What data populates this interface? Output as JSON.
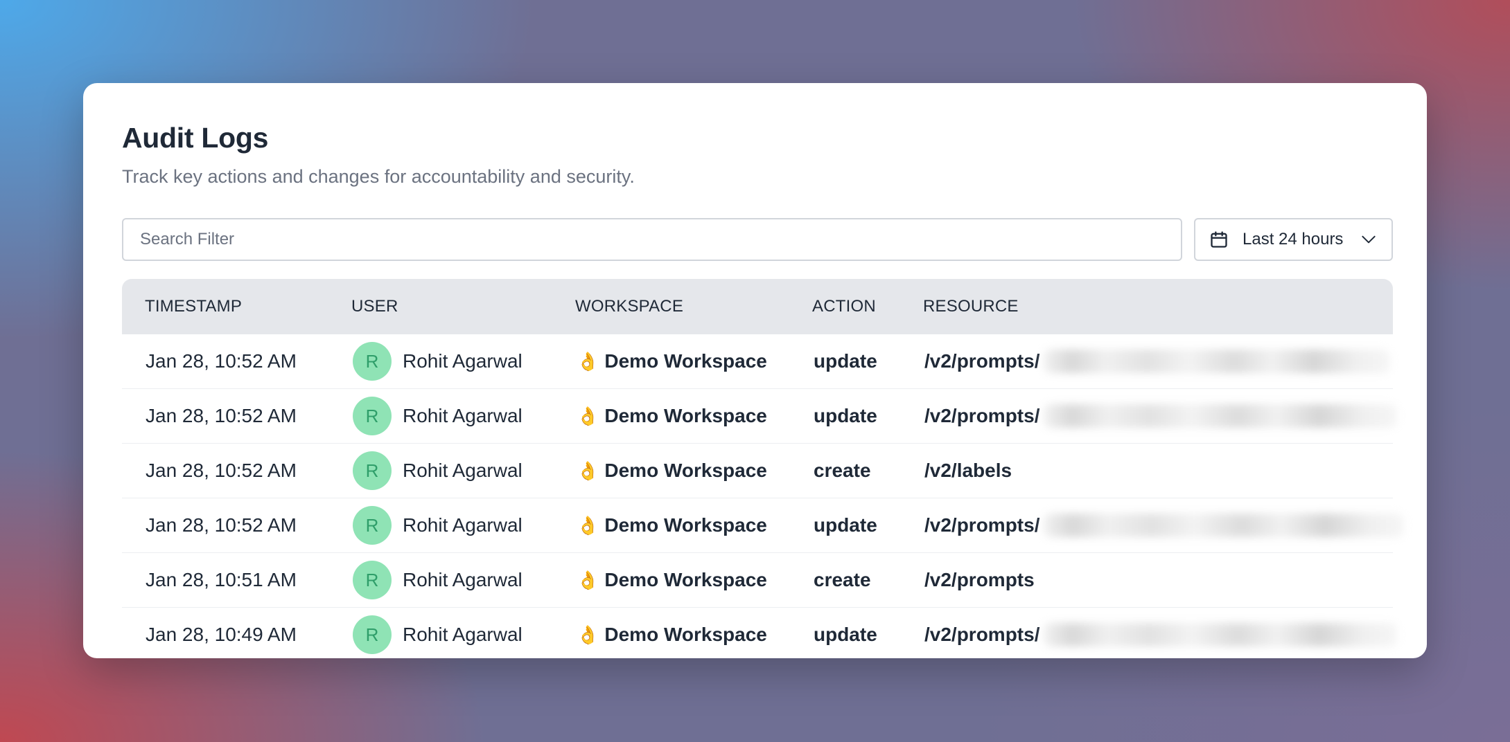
{
  "page": {
    "title": "Audit Logs",
    "subtitle": "Track key actions and changes for accountability and security."
  },
  "filters": {
    "search_placeholder": "Search Filter",
    "search_value": "",
    "time_range": "Last 24 hours"
  },
  "table": {
    "columns": [
      "TIMESTAMP",
      "USER",
      "WORKSPACE",
      "ACTION",
      "RESOURCE"
    ],
    "rows": [
      {
        "timestamp": "Jan 28, 10:52 AM",
        "avatar": "R",
        "user": "Rohit Agarwal",
        "workspace_icon": "👌",
        "workspace": "Demo Workspace",
        "action": "update",
        "resource": "/v2/prompts/",
        "redacted": true
      },
      {
        "timestamp": "Jan 28, 10:52 AM",
        "avatar": "R",
        "user": "Rohit Agarwal",
        "workspace_icon": "👌",
        "workspace": "Demo Workspace",
        "action": "update",
        "resource": "/v2/prompts/",
        "redacted": true
      },
      {
        "timestamp": "Jan 28, 10:52 AM",
        "avatar": "R",
        "user": "Rohit Agarwal",
        "workspace_icon": "👌",
        "workspace": "Demo Workspace",
        "action": "create",
        "resource": "/v2/labels",
        "redacted": false
      },
      {
        "timestamp": "Jan 28, 10:52 AM",
        "avatar": "R",
        "user": "Rohit Agarwal",
        "workspace_icon": "👌",
        "workspace": "Demo Workspace",
        "action": "update",
        "resource": "/v2/prompts/",
        "redacted": true
      },
      {
        "timestamp": "Jan 28, 10:51 AM",
        "avatar": "R",
        "user": "Rohit Agarwal",
        "workspace_icon": "👌",
        "workspace": "Demo Workspace",
        "action": "create",
        "resource": "/v2/prompts",
        "redacted": false
      },
      {
        "timestamp": "Jan 28, 10:49 AM",
        "avatar": "R",
        "user": "Rohit Agarwal",
        "workspace_icon": "👌",
        "workspace": "Demo Workspace",
        "action": "update",
        "resource": "/v2/prompts/",
        "redacted": true
      }
    ]
  },
  "colors": {
    "avatar_bg": "#8fe3b5",
    "avatar_text": "#2f9e6a",
    "header_bg": "#e5e7eb"
  },
  "icons": {
    "date_range": "calendar-icon",
    "dropdown": "chevron-down-icon"
  }
}
